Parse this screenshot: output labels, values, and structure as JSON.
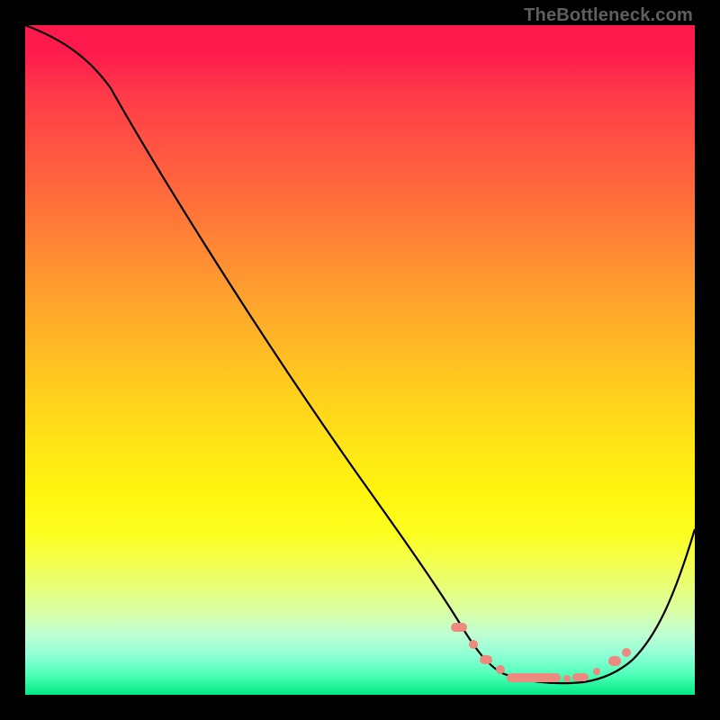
{
  "attribution": "TheBottleneck.com",
  "chart_data": {
    "type": "line",
    "title": "",
    "xlabel": "",
    "ylabel": "",
    "xlim": [
      0,
      100
    ],
    "ylim": [
      0,
      100
    ],
    "background": "red-yellow-green vertical gradient (bottleneck heat)",
    "series": [
      {
        "name": "bottleneck-curve",
        "x": [
          0,
          5,
          10,
          15,
          20,
          25,
          30,
          35,
          40,
          45,
          50,
          55,
          60,
          62,
          65,
          68,
          70,
          72,
          75,
          78,
          80,
          83,
          86,
          90,
          94,
          100
        ],
        "y": [
          100,
          98,
          96,
          92,
          86,
          80,
          73,
          66,
          58,
          50,
          42,
          33,
          24,
          20,
          14,
          9,
          6,
          4,
          2.5,
          2,
          2,
          2.5,
          3.5,
          6,
          12,
          25
        ]
      }
    ],
    "annotations": {
      "optimal_zone_markers_x": [
        64,
        66,
        69,
        72,
        74,
        76,
        78,
        80,
        82,
        85,
        87
      ],
      "optimal_zone_markers_y": [
        11,
        9,
        6,
        4,
        3.5,
        3,
        3,
        3,
        3.2,
        4,
        5.5
      ]
    }
  }
}
